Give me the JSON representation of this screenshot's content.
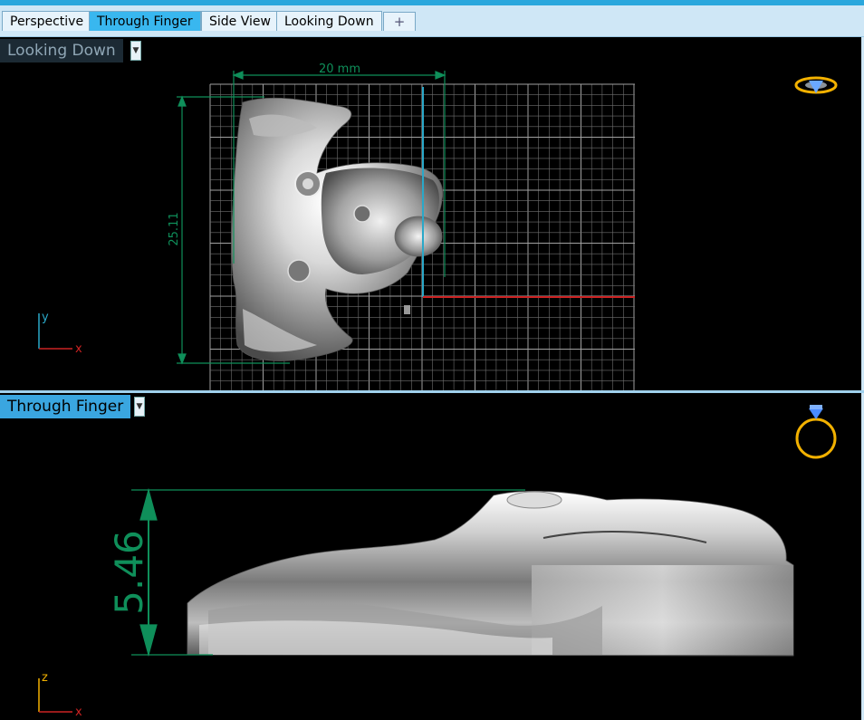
{
  "tabs": [
    {
      "label": "Perspective",
      "active": false
    },
    {
      "label": "Through Finger",
      "active": true
    },
    {
      "label": "Side View",
      "active": false
    },
    {
      "label": "Looking Down",
      "active": false
    }
  ],
  "add_tab_glyph": "+",
  "viewports": {
    "top": {
      "label": "Looking Down",
      "dim_width": "20 mm",
      "dim_height": "25.11",
      "axis_y": "y",
      "axis_x": "x",
      "orientation_icon": "ring-top-view-icon"
    },
    "bottom": {
      "label": "Through Finger",
      "dim_height": "5.46",
      "axis_z": "z",
      "axis_x": "x",
      "orientation_icon": "ring-front-view-icon"
    }
  },
  "colors": {
    "dimension": "#0f8f5a",
    "grid": "#8a8a8a",
    "x_axis": "#cc2222",
    "y_axis": "#2aa8c8",
    "gizmo": "#f2b100",
    "tab_active": "#39b7ef"
  }
}
